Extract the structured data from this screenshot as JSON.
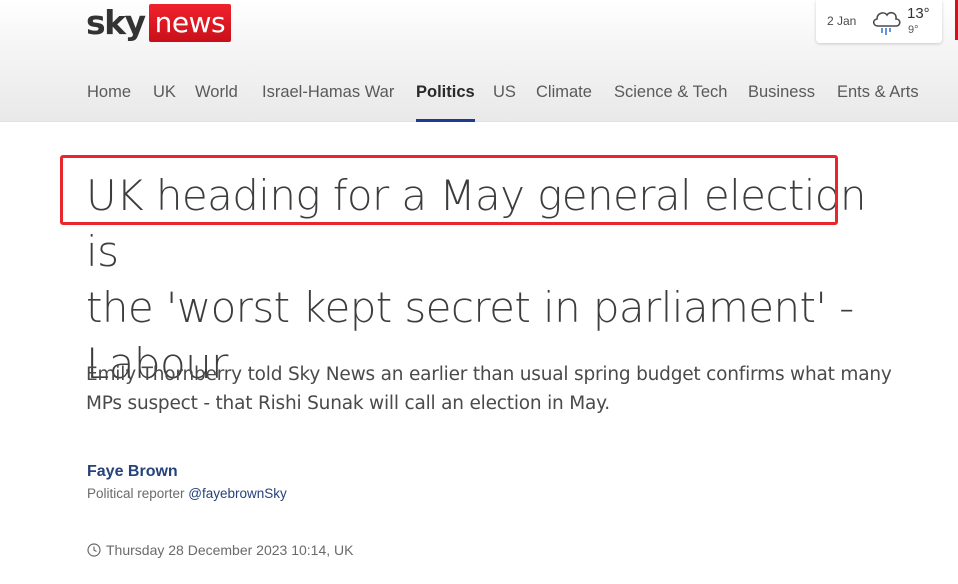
{
  "logo": {
    "sky": "sky",
    "news": "news"
  },
  "weather": {
    "date": "2 Jan",
    "high": "13°",
    "low": "9°",
    "icon": "rain-cloud-icon"
  },
  "nav": {
    "items": [
      {
        "label": "Home"
      },
      {
        "label": "UK"
      },
      {
        "label": "World"
      },
      {
        "label": "Israel-Hamas War"
      },
      {
        "label": "Politics",
        "active": true
      },
      {
        "label": "US"
      },
      {
        "label": "Climate"
      },
      {
        "label": "Science & Tech"
      },
      {
        "label": "Business"
      },
      {
        "label": "Ents & Arts"
      }
    ]
  },
  "article": {
    "headline_line1a": "UK heading for a May general election",
    "headline_line1b": " is",
    "headline_rest": "the 'worst kept secret in parliament' - Labour",
    "standfirst": "Emily Thornberry told Sky News an earlier than usual spring budget confirms what many MPs suspect - that Rishi Sunak will call an election in May.",
    "author": "Faye Brown",
    "author_role": "Political reporter",
    "author_handle": "@fayebrownSky",
    "timestamp": "Thursday 28 December 2023 10:14, UK"
  },
  "colors": {
    "brand_red": "#d0121b",
    "nav_active_underline": "#1f3a8f",
    "author_blue": "#25427a",
    "annotation_red": "#e8262b"
  }
}
